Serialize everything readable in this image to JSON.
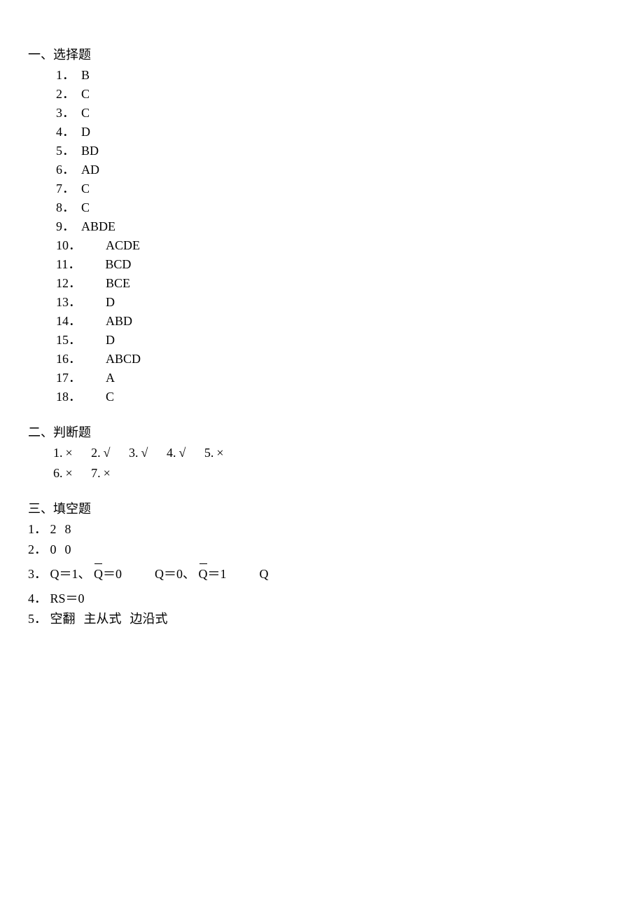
{
  "sections": {
    "s1": {
      "title": "一、选择题"
    },
    "s2": {
      "title": "二、判断题"
    },
    "s3": {
      "title": "三、填空题"
    }
  },
  "multiple_choice": [
    {
      "n": "1．",
      "a": "B"
    },
    {
      "n": "2．",
      "a": "C"
    },
    {
      "n": "3．",
      "a": "C"
    },
    {
      "n": "4．",
      "a": "D"
    },
    {
      "n": "5．",
      "a": "BD"
    },
    {
      "n": "6．",
      "a": "AD"
    },
    {
      "n": "7．",
      "a": "C"
    },
    {
      "n": "8．",
      "a": "C"
    },
    {
      "n": "9．",
      "a": "ABDE"
    },
    {
      "n": "10．",
      "a": "ACDE"
    },
    {
      "n": "11．",
      "a": "BCD"
    },
    {
      "n": "12．",
      "a": "BCE"
    },
    {
      "n": "13．",
      "a": "D"
    },
    {
      "n": "14．",
      "a": "ABD"
    },
    {
      "n": "15．",
      "a": "D"
    },
    {
      "n": "16．",
      "a": "ABCD"
    },
    {
      "n": "17．",
      "a": "A"
    },
    {
      "n": "18．",
      "a": "C"
    }
  ],
  "true_false_line1": [
    {
      "n": "1.",
      "m": "×"
    },
    {
      "n": "2.",
      "m": "√"
    },
    {
      "n": "3.",
      "m": "√"
    },
    {
      "n": "4.",
      "m": "√"
    },
    {
      "n": "5.",
      "m": "×"
    }
  ],
  "true_false_line2": [
    {
      "n": "6.",
      "m": "×"
    },
    {
      "n": "7.",
      "m": "×"
    }
  ],
  "fill": {
    "q1": {
      "n": "1．",
      "a1": "2",
      "a2": "8"
    },
    "q2": {
      "n": "2．",
      "a1": "0",
      "a2": "0"
    },
    "q3": {
      "n": "3．",
      "p1a": "Q＝1",
      "p1sep": "、",
      "p1b_sym": "Q",
      "p1b_eq": "＝0",
      "p2a": "Q＝0",
      "p2sep": "、",
      "p2b_sym": "Q",
      "p2b_eq": "＝1",
      "tail": "Q"
    },
    "q4": {
      "n": "4．",
      "a": "RS＝0"
    },
    "q5": {
      "n": "5．",
      "a1": "空翻",
      "a2": "主从式",
      "a3": "边沿式"
    }
  }
}
